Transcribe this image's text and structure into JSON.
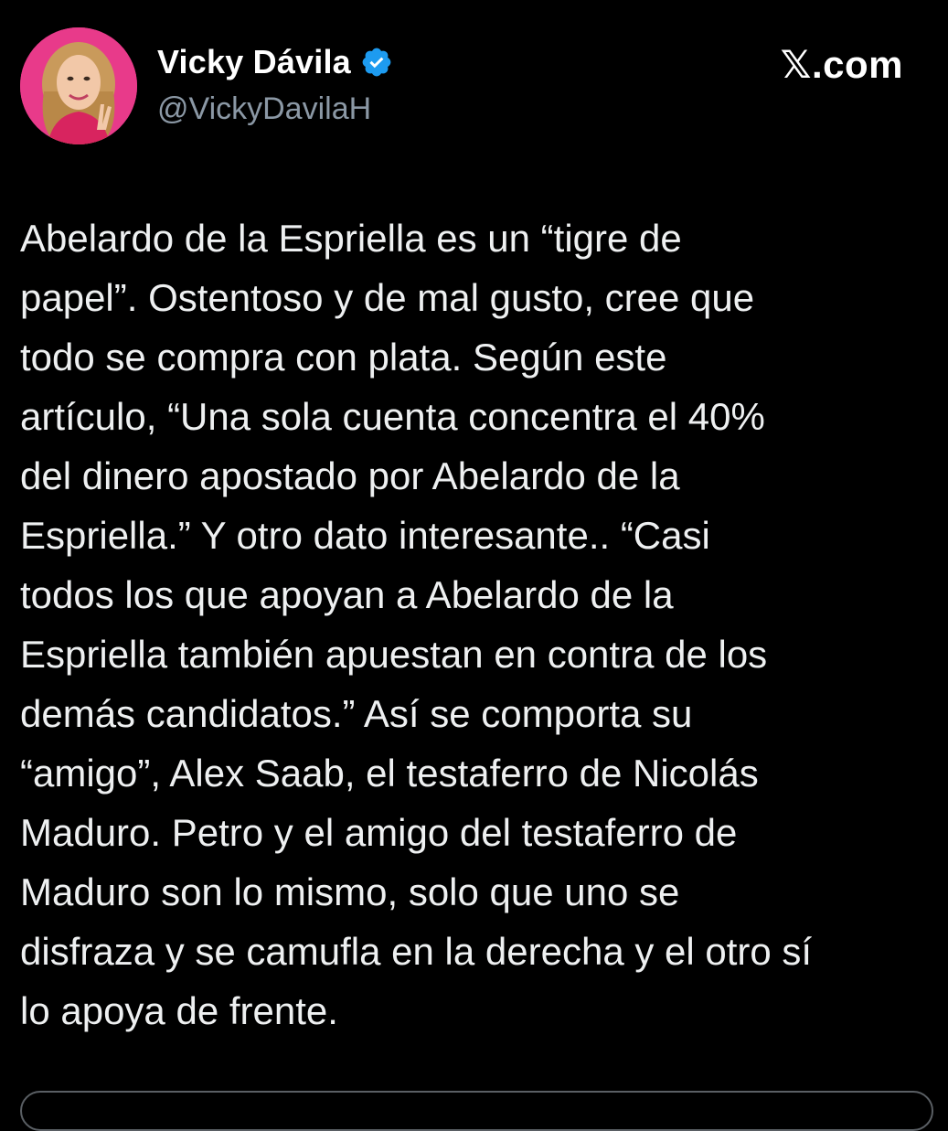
{
  "author": {
    "display_name": "Vicky Dávila",
    "handle": "@VickyDavilaH",
    "verified_icon": "verified-badge-icon",
    "avatar_icon": "profile-photo"
  },
  "brand": {
    "label": "𝕏.com"
  },
  "tweet": {
    "text": "Abelardo de la Espriella es un “tigre de\npapel”. Ostentoso y de mal gusto, cree que\ntodo se compra con plata. Según este\nartículo, “Una sola cuenta concentra el 40%\ndel dinero apostado por Abelardo de la\nEspriella.” Y otro dato interesante.. “Casi\ntodos los que apoyan a Abelardo de la\nEspriella también apuestan en contra de los\ndemás candidatos.” Así se comporta su\n“amigo”, Alex Saab, el testaferro de Nicolás\nMaduro. Petro y el amigo del testaferro de\nMaduro son lo mismo, solo que uno se\ndisfraza y se camufla en la derecha y el otro sí\nlo apoya de frente."
  },
  "colors": {
    "background": "#000000",
    "text": "#e7e9ea",
    "handle": "#8b98a5",
    "verified": "#1d9bf0",
    "avatar_bg": "#e83a8a"
  }
}
